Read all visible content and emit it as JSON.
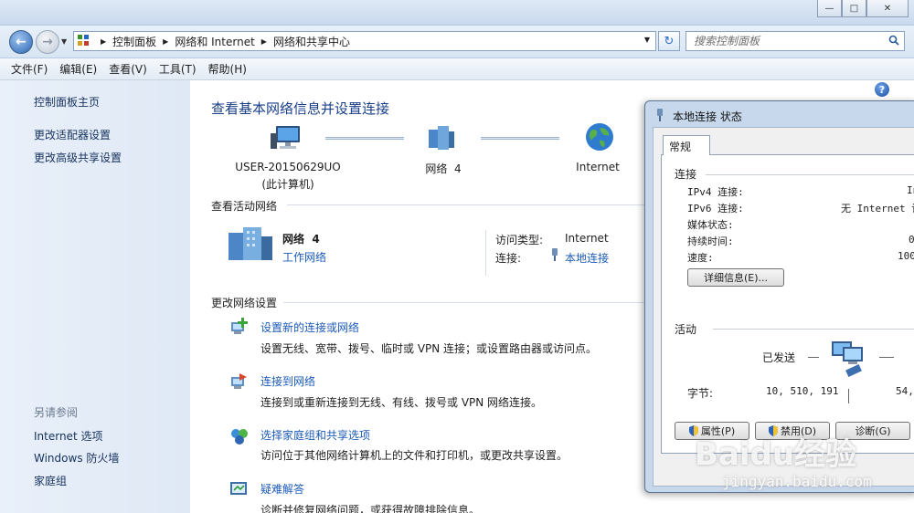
{
  "window": {
    "minimize_icon": "minimize-icon",
    "maximize_icon": "maximize-icon",
    "close_icon": "close-icon"
  },
  "address": {
    "crumbs": [
      "控制面板",
      "网络和 Internet",
      "网络和共享中心"
    ],
    "search_placeholder": "搜索控制面板"
  },
  "menu": [
    "文件(F)",
    "编辑(E)",
    "查看(V)",
    "工具(T)",
    "帮助(H)"
  ],
  "sidebar": {
    "links": [
      "控制面板主页",
      "更改适配器设置",
      "更改高级共享设置"
    ],
    "see_also_heading": "另请参阅",
    "see_also": [
      "Internet 选项",
      "Windows 防火墙",
      "家庭组"
    ]
  },
  "main": {
    "title": "查看基本网络信息并设置连接",
    "map": {
      "computer_name": "USER-20150629UO",
      "computer_sub": "(此计算机)",
      "network": "网络  4",
      "internet": "Internet"
    },
    "active_heading": "查看活动网络",
    "active": {
      "name": "网络  4",
      "type_link": "工作网络",
      "access_label": "访问类型:",
      "access_value": "Internet",
      "conn_label": "连接:",
      "conn_value": "本地连接"
    },
    "change_heading": "更改网络设置",
    "tasks": [
      {
        "link": "设置新的连接或网络",
        "desc": "设置无线、宽带、拨号、临时或 VPN 连接；或设置路由器或访问点。"
      },
      {
        "link": "连接到网络",
        "desc": "连接到或重新连接到无线、有线、拨号或 VPN 网络连接。"
      },
      {
        "link": "选择家庭组和共享选项",
        "desc": "访问位于其他网络计算机上的文件和打印机，或更改共享设置。"
      },
      {
        "link": "疑难解答",
        "desc": "诊断并修复网络问题，或获得故障排除信息。"
      }
    ]
  },
  "dialog": {
    "title": "本地连接 状态",
    "tab": "常规",
    "connection_heading": "连接",
    "rows": [
      {
        "label": "IPv4 连接:",
        "value": "In"
      },
      {
        "label": "IPv6 连接:",
        "value": "无 Internet 访"
      },
      {
        "label": "媒体状态:",
        "value": ""
      },
      {
        "label": "持续时间:",
        "value": "02"
      },
      {
        "label": "速度:",
        "value": "100."
      }
    ],
    "details_button": "详细信息(E)...",
    "activity_heading": "活动",
    "sent_label": "已发送",
    "bytes_label": "字节:",
    "bytes_sent": "10, 510, 191",
    "bytes_received": "54, 3",
    "buttons": [
      "属性(P)",
      "禁用(D)",
      "诊断(G)"
    ]
  },
  "watermark": {
    "brand": "Baidu经验",
    "url": "jingyan.baidu.com"
  }
}
